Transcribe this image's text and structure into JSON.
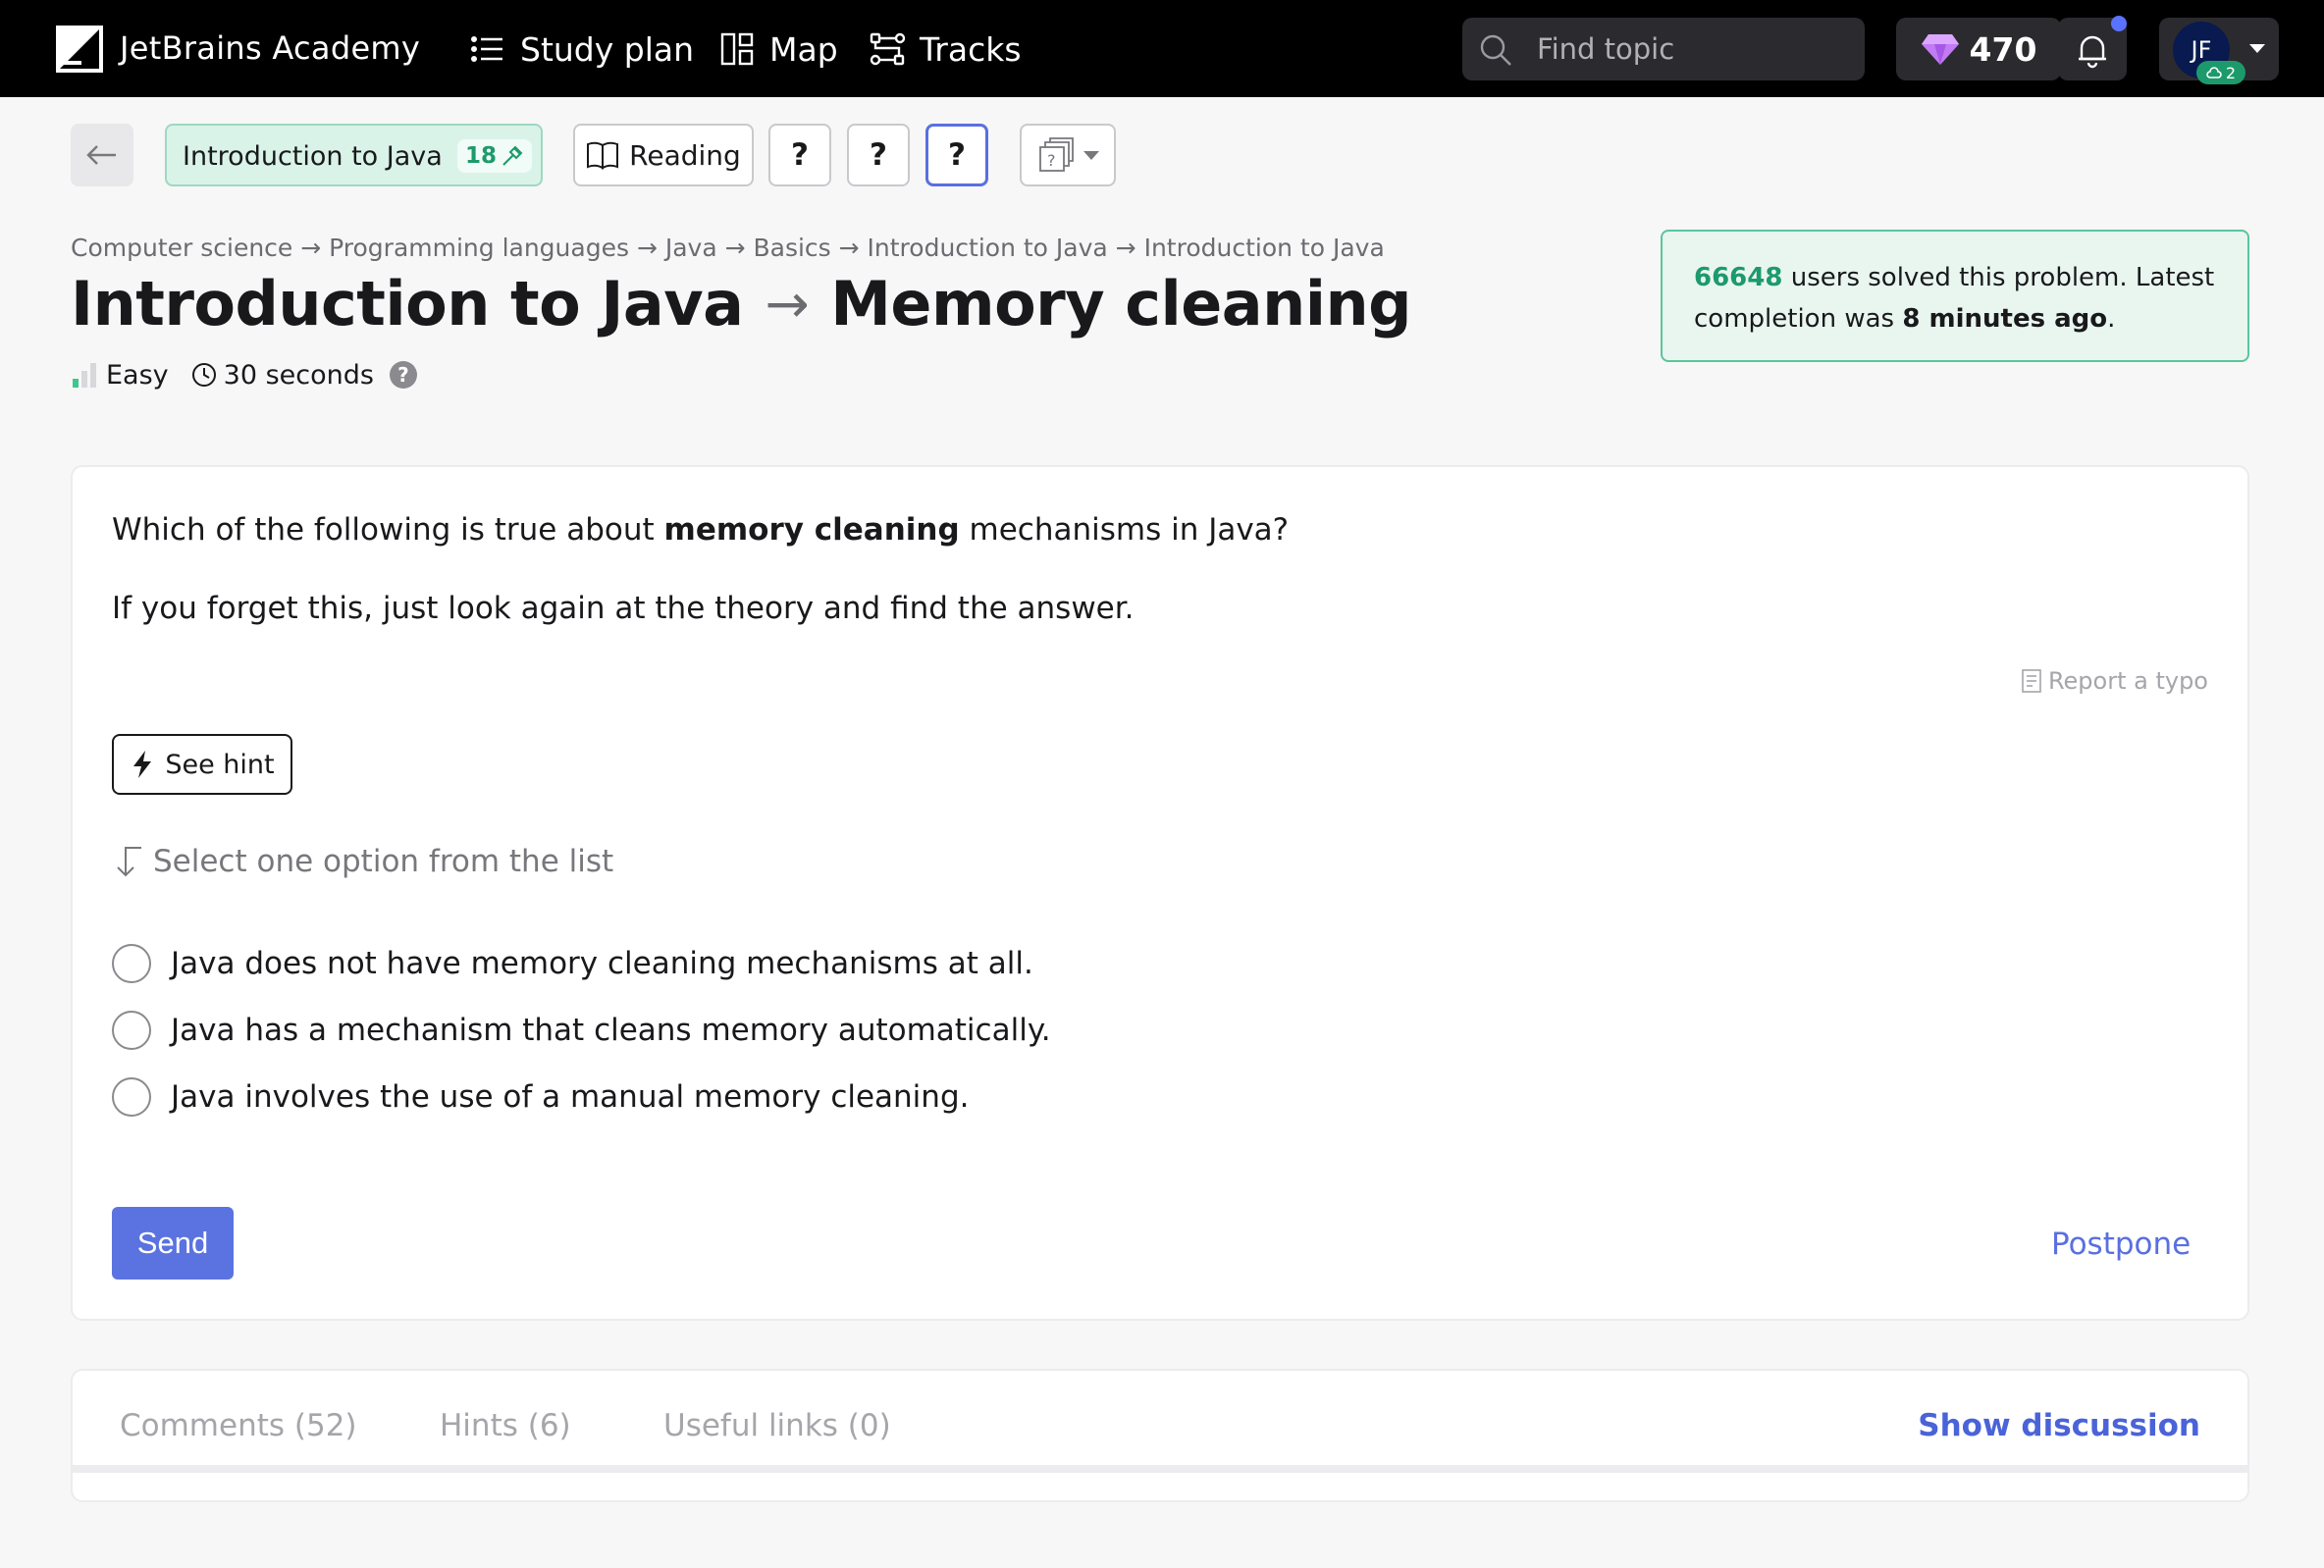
{
  "header": {
    "brand": "JetBrains Academy",
    "nav": {
      "study_plan": "Study plan",
      "map": "Map",
      "tracks": "Tracks"
    },
    "search": {
      "placeholder": "Find topic"
    },
    "gems": "470",
    "user": {
      "initials": "JF",
      "badge_count": "2"
    }
  },
  "toolbar": {
    "topic_label": "Introduction to Java",
    "topic_count": "18",
    "reading_label": "Reading",
    "step1": "?",
    "step2": "?",
    "step3": "?"
  },
  "breadcrumb": "Computer science → Programming languages → Java → Basics → Introduction to Java → Introduction to Java",
  "title": {
    "topic": "Introduction to Java",
    "arrow": "→",
    "problem": "Memory cleaning"
  },
  "meta": {
    "difficulty": "Easy",
    "duration": "30 seconds",
    "help": "?"
  },
  "solved": {
    "count": "66648",
    "text_a": " users solved this problem. Latest completion was ",
    "time": "8 minutes ago",
    "text_b": "."
  },
  "question": {
    "text_before": "Which of the following is true about ",
    "text_bold": "memory cleaning",
    "text_after": " mechanisms in Java?",
    "subtext": "If you forget this, just look again at the theory and find the answer.",
    "report_typo": "Report a typo",
    "hint_label": "See hint",
    "select_label": "Select one option from the list",
    "options": [
      "Java does not have memory cleaning mechanisms at all.",
      "Java has a mechanism that cleans memory automatically.",
      "Java involves the use of a manual memory cleaning."
    ],
    "send_label": "Send",
    "postpone_label": "Postpone"
  },
  "discussion": {
    "tabs": [
      "Comments (52)",
      "Hints (6)",
      "Useful links (0)"
    ],
    "show_label": "Show discussion"
  },
  "colors": {
    "accent": "#5a73e0",
    "success": "#1d9a6c",
    "topbar": "#000000"
  }
}
